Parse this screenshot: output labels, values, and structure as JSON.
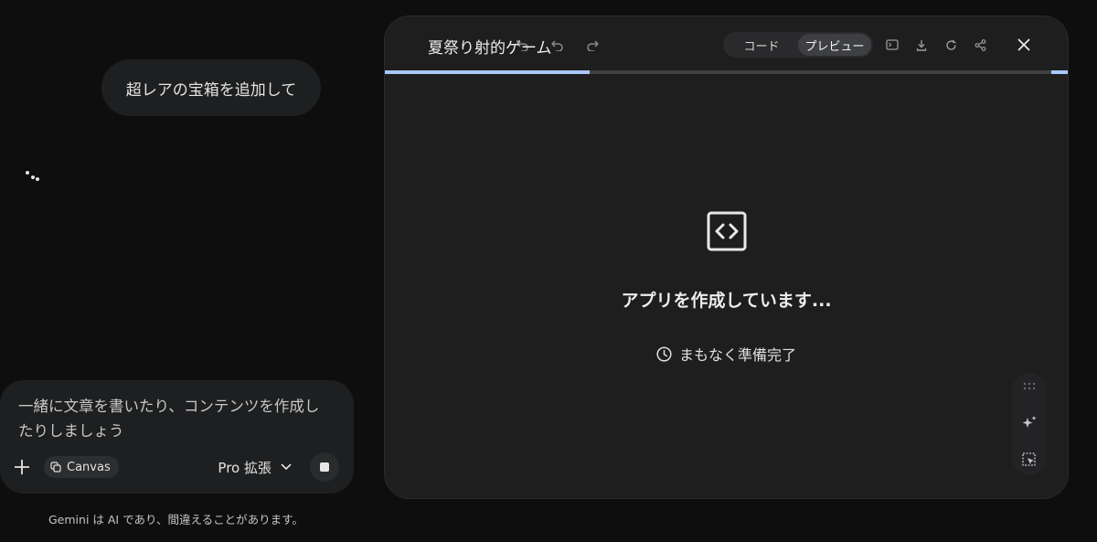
{
  "chat": {
    "user_message": "超レアの宝箱を追加して"
  },
  "composer": {
    "placeholder": "一緒に文章を書いたり、コンテンツを作成したりしましょう",
    "canvas_chip": "Canvas",
    "model_label": "Pro 拡張"
  },
  "disclaimer": "Gemini は AI であり、間違えることがあります。",
  "canvas": {
    "title": "夏祭り射的ゲーム",
    "toggle_code": "コード",
    "toggle_preview": "プレビュー",
    "status_title": "アプリを作成しています...",
    "status_sub": "まもなく準備完了",
    "progress": 0.3
  },
  "icons": {
    "plus": "plus-icon",
    "canvas": "canvas-icon",
    "model_dropdown": "chevron-down-icon",
    "stop": "stop-icon",
    "undo": "undo-icon",
    "redo": "redo-icon",
    "console": "console-icon",
    "download": "download-icon",
    "refresh": "refresh-icon",
    "share": "share-icon",
    "close": "close-icon",
    "code": "code-icon",
    "clock": "clock-icon",
    "grid": "grid-icon",
    "sparkle": "sparkle-icon",
    "select": "select-element-icon"
  },
  "colors": {
    "background": "#0e0e0f",
    "panel": "#1e1e1f",
    "accent_progress": "#a8c7fa"
  }
}
